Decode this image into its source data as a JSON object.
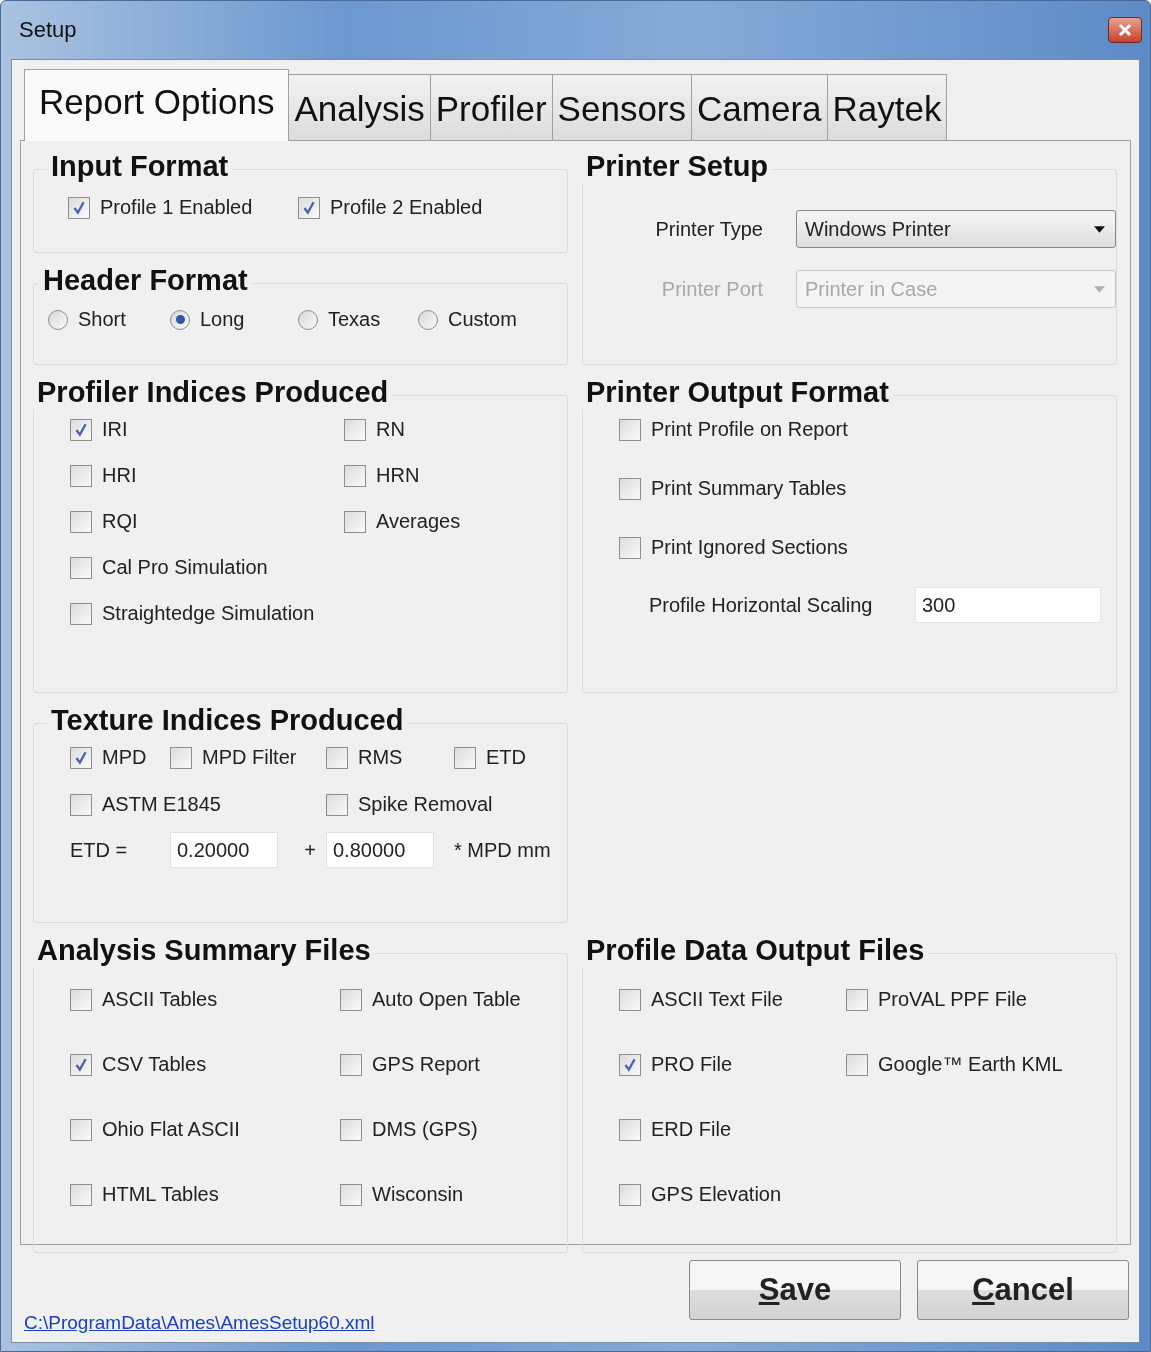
{
  "window": {
    "title": "Setup"
  },
  "tabs": [
    {
      "label": "Report Options",
      "selected": true
    },
    {
      "label": "Analysis",
      "selected": false
    },
    {
      "label": "Profiler",
      "selected": false
    },
    {
      "label": "Sensors",
      "selected": false
    },
    {
      "label": "Camera",
      "selected": false
    },
    {
      "label": "Raytek",
      "selected": false
    }
  ],
  "sections": [
    {
      "title": "Input Format",
      "rows": [
        [
          {
            "kind": "checkbox",
            "label": "Profile 1 Enabled",
            "checked": true
          },
          {
            "kind": "checkbox",
            "label": "Profile 2 Enabled",
            "checked": true
          }
        ]
      ]
    },
    {
      "title": "Printer Setup",
      "rows": [
        [
          {
            "kind": "label",
            "text": "Printer Type",
            "disabled": false
          },
          {
            "kind": "select",
            "value": "Windows Printer",
            "disabled": false
          }
        ],
        [
          {
            "kind": "label",
            "text": "Printer Port",
            "disabled": true
          },
          {
            "kind": "select",
            "value": "Printer in Case",
            "disabled": true
          }
        ]
      ]
    },
    {
      "title": "Header Format",
      "rows": [
        [
          {
            "kind": "radio",
            "label": "Short",
            "selected": false
          },
          {
            "kind": "radio",
            "label": "Long",
            "selected": true
          },
          {
            "kind": "radio",
            "label": "Texas",
            "selected": false
          },
          {
            "kind": "radio",
            "label": "Custom",
            "selected": false
          }
        ]
      ]
    },
    {
      "title": "Profiler Indices Produced",
      "rows": [
        [
          {
            "kind": "checkbox",
            "label": "IRI",
            "checked": true
          },
          {
            "kind": "checkbox",
            "label": "RN",
            "checked": false
          }
        ],
        [
          {
            "kind": "checkbox",
            "label": "HRI",
            "checked": false
          },
          {
            "kind": "checkbox",
            "label": "HRN",
            "checked": false
          }
        ],
        [
          {
            "kind": "checkbox",
            "label": "RQI",
            "checked": false
          },
          {
            "kind": "checkbox",
            "label": "Averages",
            "checked": false
          }
        ],
        [
          {
            "kind": "checkbox",
            "label": "Cal Pro Simulation",
            "checked": false
          }
        ],
        [
          {
            "kind": "checkbox",
            "label": "Straightedge Simulation",
            "checked": false
          }
        ]
      ]
    },
    {
      "title": "Printer Output Format",
      "rows": [
        [
          {
            "kind": "checkbox",
            "label": "Print Profile on Report",
            "checked": false
          }
        ],
        [
          {
            "kind": "checkbox",
            "label": "Print Summary Tables",
            "checked": false
          }
        ],
        [
          {
            "kind": "checkbox",
            "label": "Print Ignored Sections",
            "checked": false
          }
        ],
        [
          {
            "kind": "label",
            "text": "Profile Horizontal Scaling",
            "disabled": false
          },
          {
            "kind": "field",
            "value": "300"
          }
        ]
      ]
    },
    {
      "title": "Texture Indices Produced",
      "rows": [
        [
          {
            "kind": "checkbox",
            "label": "MPD",
            "checked": true
          },
          {
            "kind": "checkbox",
            "label": "MPD Filter",
            "checked": false
          },
          "",
          {
            "kind": "checkbox",
            "label": "RMS",
            "checked": false
          },
          {
            "kind": "checkbox",
            "label": "ETD",
            "checked": false
          }
        ],
        [
          {
            "kind": "checkbox",
            "label": "ASTM E1845",
            "checked": false
          },
          "",
          "",
          {
            "kind": "checkbox",
            "label": "Spike Removal",
            "checked": false
          }
        ],
        [
          {
            "kind": "label",
            "text": "ETD =",
            "disabled": false
          },
          {
            "kind": "field",
            "value": "0.20000"
          },
          {
            "kind": "label",
            "text": "+",
            "disabled": false
          },
          {
            "kind": "field",
            "value": "0.80000"
          },
          {
            "kind": "label",
            "text": "* MPD mm",
            "disabled": false
          }
        ]
      ]
    },
    {
      "title": "Analysis Summary Files",
      "rows": [
        [
          {
            "kind": "checkbox",
            "label": "ASCII Tables",
            "checked": false
          },
          {
            "kind": "checkbox",
            "label": "Auto Open Table",
            "checked": false
          }
        ],
        [
          {
            "kind": "checkbox",
            "label": "CSV Tables",
            "checked": true
          },
          {
            "kind": "checkbox",
            "label": "GPS Report",
            "checked": false
          }
        ],
        [
          {
            "kind": "checkbox",
            "label": "Ohio Flat ASCII",
            "checked": false
          },
          {
            "kind": "checkbox",
            "label": "DMS (GPS)",
            "checked": false
          }
        ],
        [
          {
            "kind": "checkbox",
            "label": "HTML Tables",
            "checked": false
          },
          {
            "kind": "checkbox",
            "label": "Wisconsin",
            "checked": false
          }
        ]
      ]
    },
    {
      "title": "Profile Data Output Files",
      "rows": [
        [
          {
            "kind": "checkbox",
            "label": "ASCII Text File",
            "checked": false
          },
          {
            "kind": "checkbox",
            "label": "ProVAL PPF File",
            "checked": false
          }
        ],
        [
          {
            "kind": "checkbox",
            "label": "PRO File",
            "checked": true
          },
          {
            "kind": "checkbox",
            "label": "Google™ Earth KML",
            "checked": false
          }
        ],
        [
          {
            "kind": "checkbox",
            "label": "ERD File",
            "checked": false
          }
        ],
        [
          {
            "kind": "checkbox",
            "label": "GPS Elevation",
            "checked": false
          }
        ]
      ]
    }
  ],
  "file_link": "C:\\ProgramData\\Ames\\AmesSetup60.xml",
  "buttons": [
    "Save",
    "Cancel"
  ]
}
